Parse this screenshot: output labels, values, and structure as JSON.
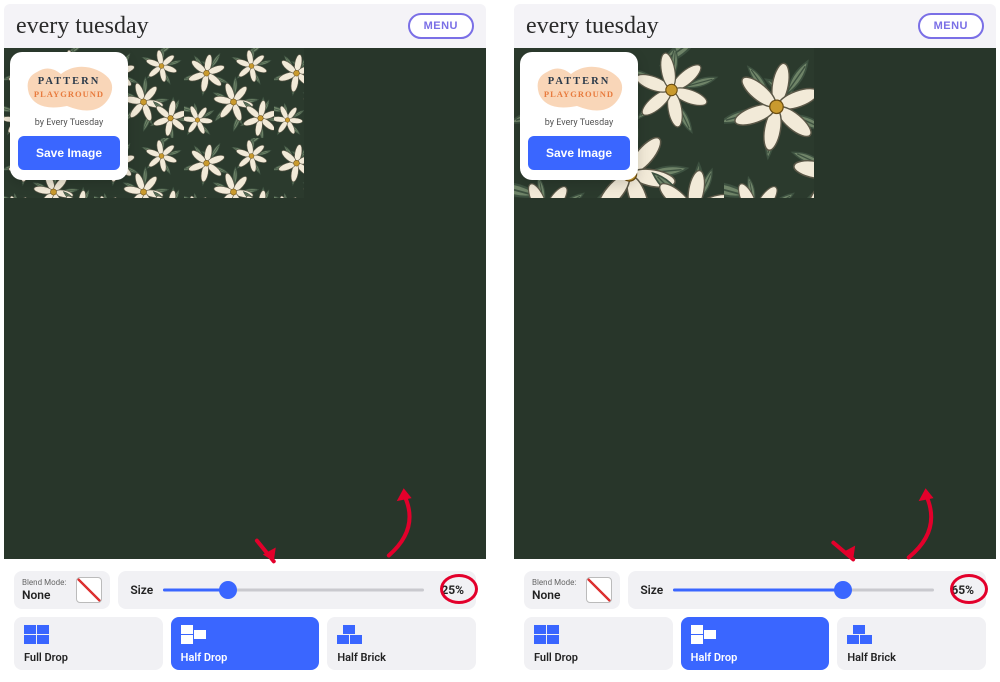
{
  "panels": [
    {
      "brand": "every tuesday",
      "menu_label": "MENU",
      "logo_top": "PATTERN",
      "logo_bottom": "PLAYGROUND",
      "byline": "by Every Tuesday",
      "save_label": "Save Image",
      "blend": {
        "label": "Blend Mode:",
        "value": "None"
      },
      "size": {
        "label": "Size",
        "value": "25%",
        "percent": 25
      },
      "modes": [
        {
          "label": "Full Drop",
          "active": false
        },
        {
          "label": "Half Drop",
          "active": true
        },
        {
          "label": "Half Brick",
          "active": false
        }
      ],
      "pattern_scale": 90
    },
    {
      "brand": "every tuesday",
      "menu_label": "MENU",
      "logo_top": "PATTERN",
      "logo_bottom": "PLAYGROUND",
      "byline": "by Every Tuesday",
      "save_label": "Save Image",
      "blend": {
        "label": "Blend Mode:",
        "value": "None"
      },
      "size": {
        "label": "Size",
        "value": "65%",
        "percent": 65
      },
      "modes": [
        {
          "label": "Full Drop",
          "active": false
        },
        {
          "label": "Half Drop",
          "active": true
        },
        {
          "label": "Half Brick",
          "active": false
        }
      ],
      "pattern_scale": 210
    }
  ]
}
